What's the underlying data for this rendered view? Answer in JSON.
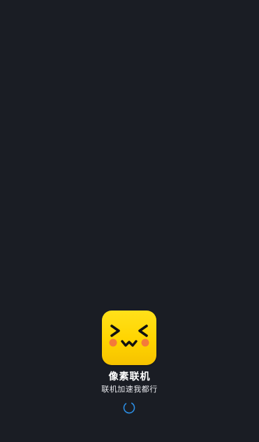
{
  "app": {
    "name": "像素联机",
    "slogan": "联机加速我都行"
  },
  "icons": {
    "app_icon": "pixel-face-icon",
    "loading": "loading-spinner-icon"
  },
  "colors": {
    "background": "#1a1d24",
    "icon_yellow": "#ffd400",
    "icon_face": "#111111",
    "cheek": "#f47a3a",
    "spinner": "#2b8de3",
    "title_text": "#ffffff",
    "slogan_text": "#e7e8ec"
  }
}
